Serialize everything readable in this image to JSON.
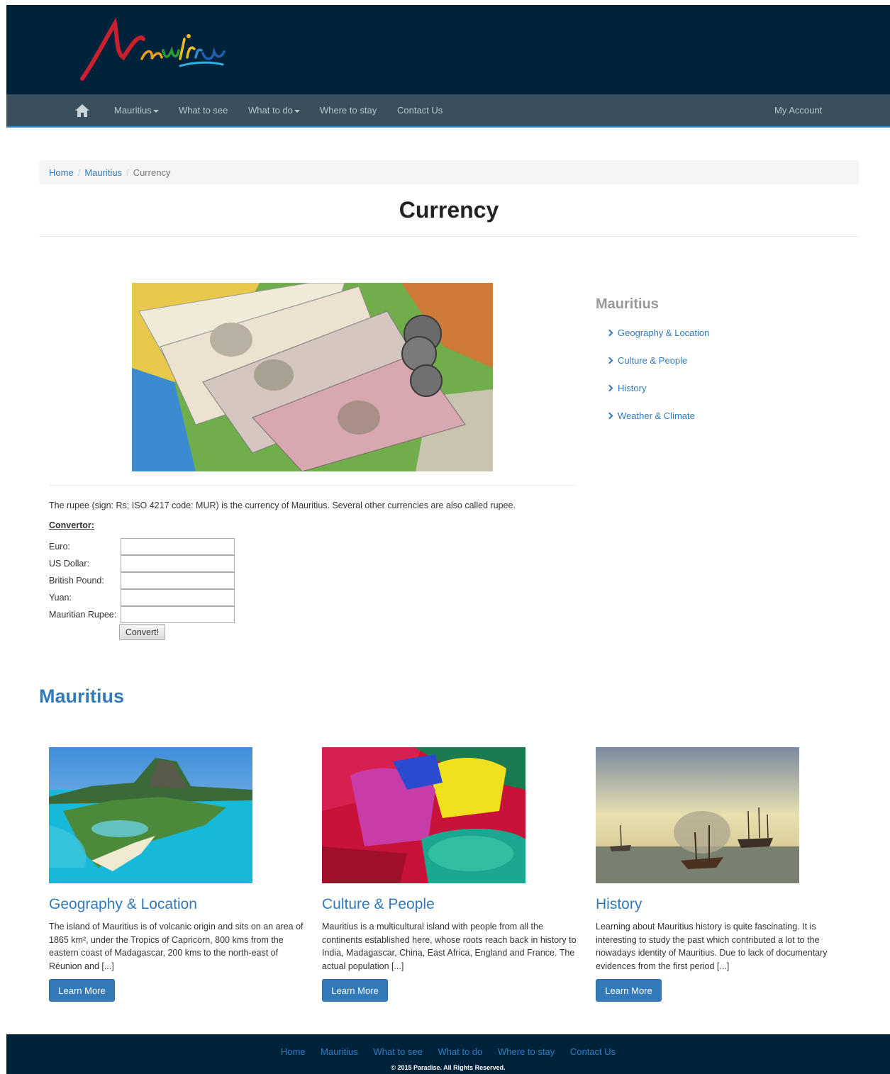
{
  "nav": {
    "items": [
      {
        "label": "Mauritius",
        "dropdown": true
      },
      {
        "label": "What to see",
        "dropdown": false
      },
      {
        "label": "What to do",
        "dropdown": true
      },
      {
        "label": "Where to stay",
        "dropdown": false
      },
      {
        "label": "Contact Us",
        "dropdown": false
      }
    ],
    "account": "My Account",
    "home_icon": "home-icon"
  },
  "breadcrumb": {
    "home": "Home",
    "section": "Mauritius",
    "current": "Currency",
    "separator": "/"
  },
  "page": {
    "title": "Currency",
    "intro": "The rupee (sign: Rs; ISO 4217 code: MUR) is the currency of Mauritius. Several other currencies are also called rupee.",
    "convertor_title": "Convertor:",
    "convertor_fields": [
      {
        "label": "Euro:",
        "value": ""
      },
      {
        "label": "US Dollar:",
        "value": ""
      },
      {
        "label": "British Pound:",
        "value": ""
      },
      {
        "label": "Yuan:",
        "value": ""
      },
      {
        "label": "Mauritian Rupee:",
        "value": ""
      }
    ],
    "convert_button": "Convert!"
  },
  "sidebar": {
    "title": "Mauritius",
    "links": [
      "Geography & Location",
      "Culture & People",
      "History",
      "Weather & Climate"
    ]
  },
  "section": {
    "title": "Mauritius",
    "cards": [
      {
        "title": "Geography & Location",
        "text": "The island of Mauritius is of volcanic origin and sits on an area of 1865 km², under the Tropics of Capricorn, 800 kms from the eastern coast of Madagascar, 200 kms to the north-east of Réunion and [...]",
        "button": "Learn More"
      },
      {
        "title": "Culture & People",
        "text": "Mauritius is a multicultural island with people from all the continents established here, whose roots reach back in history to India, Madagascar, China, East Africa, England and France. The actual population [...]",
        "button": "Learn More"
      },
      {
        "title": "History",
        "text": "Learning about Mauritius history is quite fascinating. It is interesting to study the past which contributed a lot to the nowadays identity of Mauritius. Due to lack of documentary evidences from the first period [...]",
        "button": "Learn More"
      }
    ]
  },
  "footer": {
    "links": [
      "Home",
      "Mauritius",
      "What to see",
      "What to do",
      "Where to stay",
      "Contact Us"
    ],
    "copyright": "© 2015 Paradise. All Rights Reserved."
  },
  "colors": {
    "header_bg": "#00223a",
    "nav_bg": "#3a4e5c",
    "link": "#337ab7",
    "button": "#337ab7"
  }
}
